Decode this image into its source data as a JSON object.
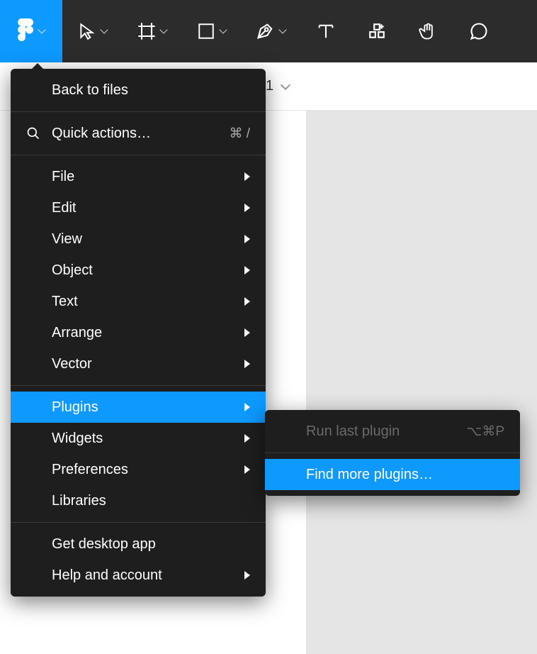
{
  "toolbar": {
    "tools": [
      "move",
      "frame",
      "rectangle",
      "pen",
      "text",
      "resources",
      "hand",
      "comment"
    ]
  },
  "page_header": {
    "visible_text": "1"
  },
  "main_menu": {
    "back": "Back to files",
    "quick_actions": "Quick actions…",
    "quick_actions_shortcut": "⌘ /",
    "items_group1": [
      "File",
      "Edit",
      "View",
      "Object",
      "Text",
      "Arrange",
      "Vector"
    ],
    "items_group2": [
      "Plugins",
      "Widgets",
      "Preferences",
      "Libraries"
    ],
    "items_group3": [
      "Get desktop app",
      "Help and account"
    ],
    "highlighted": "Plugins",
    "submenu_items": {
      "File": true,
      "Edit": true,
      "View": true,
      "Object": true,
      "Text": true,
      "Arrange": true,
      "Vector": true,
      "Plugins": true,
      "Widgets": true,
      "Preferences": true,
      "Help and account": true
    }
  },
  "submenu": {
    "run_last": "Run last plugin",
    "run_last_shortcut": "⌥⌘P",
    "find_more": "Find more plugins…",
    "highlighted": "Find more plugins…"
  },
  "colors": {
    "accent": "#0d99ff",
    "menu_bg": "#1e1e1e",
    "toolbar_bg": "#2c2c2c"
  }
}
